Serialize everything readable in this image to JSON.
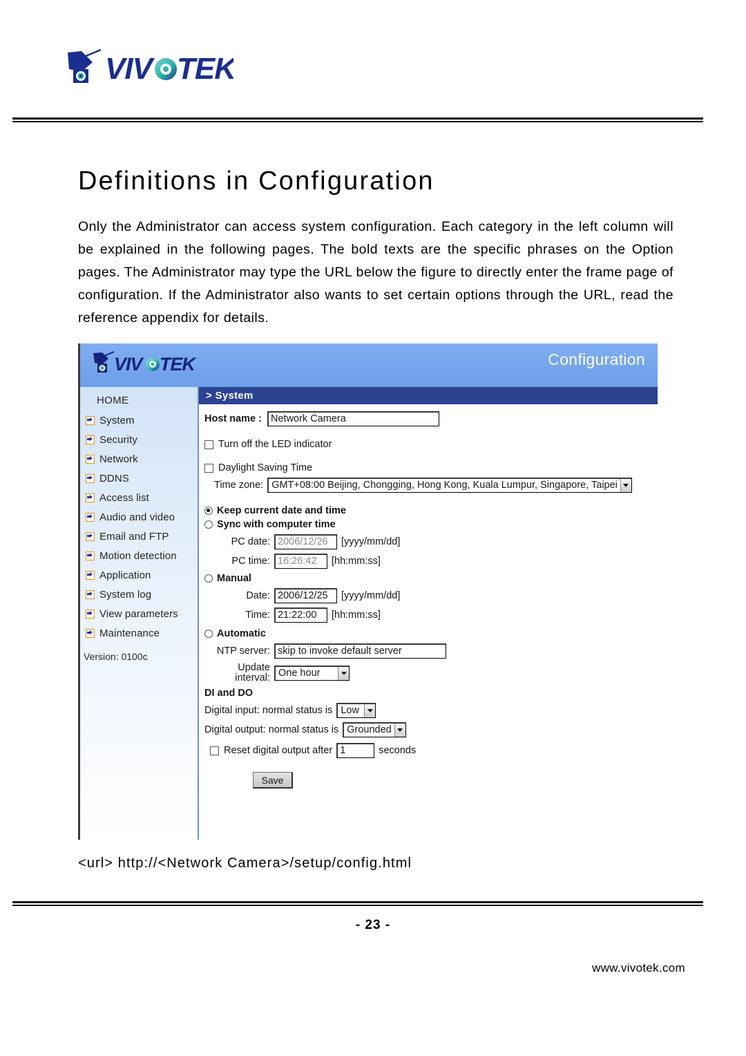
{
  "document": {
    "brand": "VIVOTEK",
    "title": "Definitions in Configuration",
    "paragraph": "Only the Administrator can access system configuration. Each category in the left column will be explained in the following pages. The bold texts are the specific phrases on the Option pages. The Administrator may type the URL below the figure to directly enter the frame page of configuration. If the Administrator also wants to set certain options through the URL, read the reference appendix for details.",
    "url_caption": "<url> http://<Network Camera>/setup/config.html",
    "page_number": "- 23 -",
    "site": "www.vivotek.com"
  },
  "figure": {
    "header": {
      "logo": "VIVOTEK",
      "title": "Configuration"
    },
    "sidebar": {
      "home": "HOME",
      "items": [
        {
          "label": "System",
          "icon": "arrow-right-icon"
        },
        {
          "label": "Security",
          "icon": "arrow-right-icon"
        },
        {
          "label": "Network",
          "icon": "arrow-right-icon"
        },
        {
          "label": "DDNS",
          "icon": "arrow-right-icon"
        },
        {
          "label": "Access list",
          "icon": "arrow-right-icon"
        },
        {
          "label": "Audio and video",
          "icon": "arrow-right-icon"
        },
        {
          "label": "Email and FTP",
          "icon": "arrow-right-icon"
        },
        {
          "label": "Motion detection",
          "icon": "arrow-right-icon"
        },
        {
          "label": "Application",
          "icon": "arrow-right-icon"
        },
        {
          "label": "System log",
          "icon": "arrow-right-icon"
        },
        {
          "label": "View parameters",
          "icon": "arrow-right-icon"
        },
        {
          "label": "Maintenance",
          "icon": "arrow-right-icon"
        }
      ],
      "version": "Version: 0100c"
    },
    "breadcrumb": "> System",
    "form": {
      "host_name_label": "Host name :",
      "host_name_value": "Network Camera",
      "led_checkbox_label": "Turn off the LED indicator",
      "dst_checkbox_label": "Daylight Saving Time",
      "time_zone_label": "Time zone:",
      "time_zone_value": "GMT+08:00 Beijing, Chongging, Hong Kong, Kuala Lumpur, Singapore, Taipei",
      "keep_current_label": "Keep current date and time",
      "sync_computer_label": "Sync with computer time",
      "pc_date_label": "PC date:",
      "pc_date_value": "2006/12/26",
      "pc_date_format": "[yyyy/mm/dd]",
      "pc_time_label": "PC time:",
      "pc_time_value": "16:26:42",
      "pc_time_format": "[hh:mm:ss]",
      "manual_label": "Manual",
      "date_label": "Date:",
      "date_value": "2006/12/25",
      "date_format": "[yyyy/mm/dd]",
      "time_label": "Time:",
      "time_value": "21:22:00",
      "time_format": "[hh:mm:ss]",
      "automatic_label": "Automatic",
      "ntp_server_label": "NTP server:",
      "ntp_server_value": "skip to invoke default server",
      "update_interval_label_line1": "Update",
      "update_interval_label_line2": "interval:",
      "update_interval_value": "One hour",
      "di_do_heading": "DI and DO",
      "digital_input_label": "Digital input: normal status is",
      "digital_input_value": "Low",
      "digital_output_label": "Digital output: normal status is",
      "digital_output_value": "Grounded",
      "reset_output_label": "Reset digital output after",
      "reset_output_value": "1",
      "reset_output_unit": "seconds",
      "save_label": "Save"
    }
  },
  "colors": {
    "header_blue": "#79a8ed",
    "crumb_blue": "#2b4391",
    "sidebar_blue": "#d3e4f8",
    "arrow_orange": "#e8921e",
    "arrow_navy": "#28379c"
  }
}
